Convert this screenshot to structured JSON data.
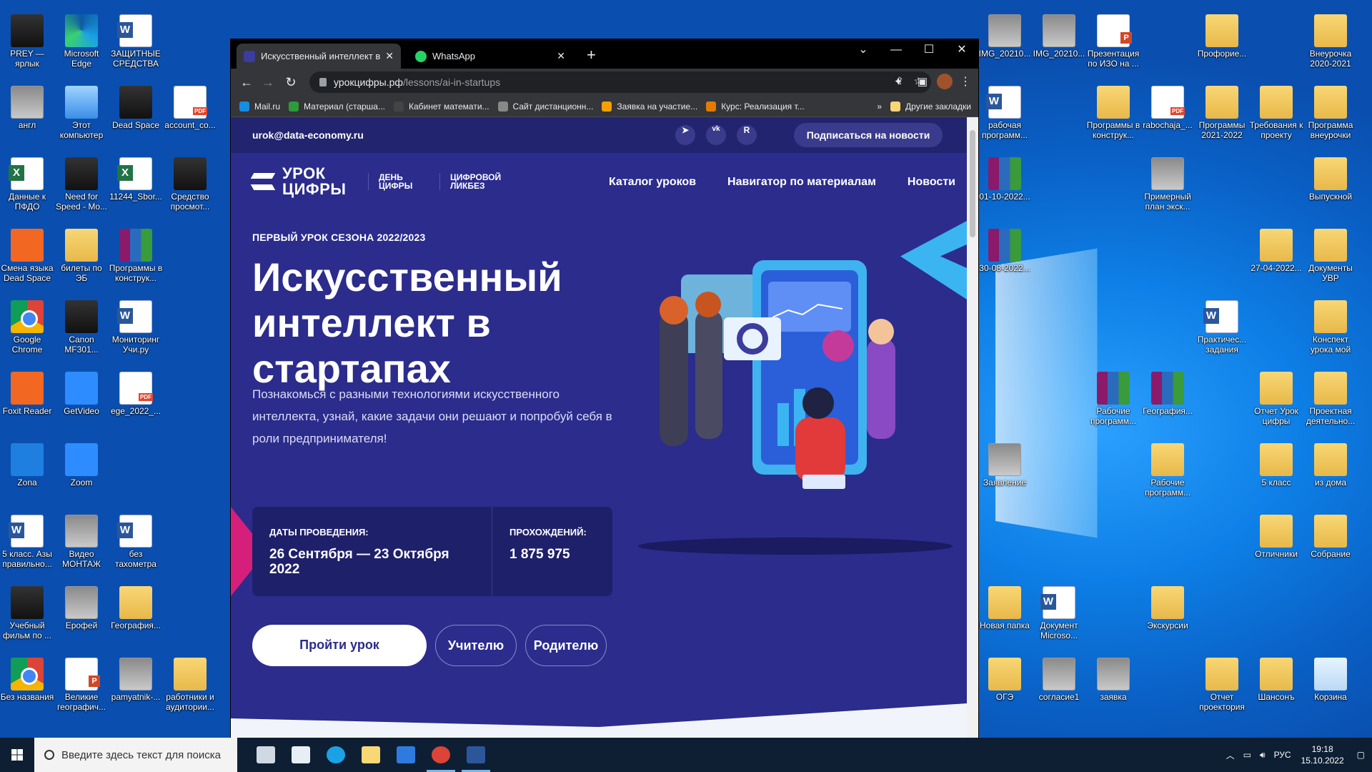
{
  "desktop": {
    "icons": [
      {
        "label": "PREY — ярлык",
        "type": "app"
      },
      {
        "label": "Microsoft Edge",
        "type": "edge"
      },
      {
        "label": "ЗАЩИТНЫЕ СРЕДСТВА",
        "type": "word"
      },
      {
        "label": "англ",
        "type": "photo"
      },
      {
        "label": "Этот компьютер",
        "type": "pc"
      },
      {
        "label": "Dead Space",
        "type": "app"
      },
      {
        "label": "account_co...",
        "type": "pdf"
      },
      {
        "label": "Данные к ПФДО",
        "type": "excel"
      },
      {
        "label": "Need for Speed - Mo...",
        "type": "app"
      },
      {
        "label": "11244_Sbor...",
        "type": "excel"
      },
      {
        "label": "Средство просмот...",
        "type": "app"
      },
      {
        "label": "Смена языка Dead Space",
        "type": "foxit"
      },
      {
        "label": "билеты по ЭБ",
        "type": "folder"
      },
      {
        "label": "Программы в конструк...",
        "type": "rar"
      },
      {
        "label": "Google Chrome",
        "type": "chrome"
      },
      {
        "label": "Canon MF301...",
        "type": "app"
      },
      {
        "label": "Мониторинг Учи.ру",
        "type": "word"
      },
      {
        "label": "Foxit Reader",
        "type": "foxit"
      },
      {
        "label": "GetVideo",
        "type": "blue"
      },
      {
        "label": "ege_2022_...",
        "type": "pdf"
      },
      {
        "label": "Zona",
        "type": "zona"
      },
      {
        "label": "Zoom",
        "type": "blue"
      },
      {
        "label": "5 класс. Азы правильно...",
        "type": "word"
      },
      {
        "label": "Видео МОНТАЖ",
        "type": "photo"
      },
      {
        "label": "без тахометра",
        "type": "word"
      },
      {
        "label": "Учебный фильм по ...",
        "type": "app"
      },
      {
        "label": "Ерофей",
        "type": "photo"
      },
      {
        "label": "География...",
        "type": "folder"
      },
      {
        "label": "Без названия",
        "type": "chrome"
      },
      {
        "label": "Великие географич...",
        "type": "ppt"
      },
      {
        "label": "pamyatnik-...",
        "type": "photo"
      },
      {
        "label": "работники и аудитории...",
        "type": "folder"
      },
      {
        "label": "IMG_20210...",
        "type": "photo"
      },
      {
        "label": "IMG_20210...",
        "type": "photo"
      },
      {
        "label": "Презентация по ИЗО на ...",
        "type": "ppt"
      },
      {
        "label": "Профорие...",
        "type": "folder"
      },
      {
        "label": "Внеурочка 2020-2021",
        "type": "folder"
      },
      {
        "label": "рабочая программ...",
        "type": "word"
      },
      {
        "label": "Программы в конструк...",
        "type": "folder"
      },
      {
        "label": "rabochaja_...",
        "type": "pdf"
      },
      {
        "label": "Программы 2021-2022",
        "type": "folder"
      },
      {
        "label": "Требования к проекту",
        "type": "folder"
      },
      {
        "label": "Программа внеурочки",
        "type": "folder"
      },
      {
        "label": "01-10-2022...",
        "type": "rar"
      },
      {
        "label": "Примерный план экск...",
        "type": "photo"
      },
      {
        "label": "Выпускной",
        "type": "folder"
      },
      {
        "label": "30-08-2022...",
        "type": "rar"
      },
      {
        "label": "27-04-2022...",
        "type": "folder"
      },
      {
        "label": "Документы УВР",
        "type": "folder"
      },
      {
        "label": "Практичес... задания",
        "type": "word"
      },
      {
        "label": "Конспект урока мой",
        "type": "folder"
      },
      {
        "label": "Рабочие программ...",
        "type": "rar"
      },
      {
        "label": "География...",
        "type": "rar"
      },
      {
        "label": "Отчет Урок цифры",
        "type": "folder"
      },
      {
        "label": "Проектная деятельно...",
        "type": "folder"
      },
      {
        "label": "Заявление",
        "type": "photo"
      },
      {
        "label": "Рабочие программ...",
        "type": "folder"
      },
      {
        "label": "5 класс",
        "type": "folder"
      },
      {
        "label": "из дома",
        "type": "folder"
      },
      {
        "label": "Отличники",
        "type": "folder"
      },
      {
        "label": "Собрание",
        "type": "folder"
      },
      {
        "label": "Новая папка",
        "type": "folder"
      },
      {
        "label": "Документ Microso...",
        "type": "word"
      },
      {
        "label": "Экскурсии",
        "type": "folder"
      },
      {
        "label": "ОГЭ",
        "type": "folder"
      },
      {
        "label": "согласие1",
        "type": "photo"
      },
      {
        "label": "заявка",
        "type": "photo"
      },
      {
        "label": "Отчет проектория",
        "type": "folder"
      },
      {
        "label": "Шансонъ",
        "type": "folder"
      },
      {
        "label": "Корзина",
        "type": "bin"
      }
    ]
  },
  "browser": {
    "tabs": [
      {
        "title": "Искусственный интеллект в ста",
        "active": true,
        "favicon_color": "#3b3c9c"
      },
      {
        "title": "WhatsApp",
        "active": false,
        "favicon_color": "#25d366"
      }
    ],
    "new_tab": "+",
    "controls": {
      "menu": "⌄",
      "minimize": "—",
      "maximize": "☐",
      "close": "✕"
    },
    "url_host": "урокцифры.рф",
    "url_path": "/lessons/ai-in-startups",
    "bookmarks": [
      {
        "label": "Mail.ru",
        "color": "#168de2"
      },
      {
        "label": "Материал (старша...",
        "color": "#2e9b3a"
      },
      {
        "label": "Кабинет математи...",
        "color": "#444"
      },
      {
        "label": "Сайт дистанционн...",
        "color": "#888"
      },
      {
        "label": "Заявка на участие...",
        "color": "#f4a100"
      },
      {
        "label": "Курс: Реализация т...",
        "color": "#e37b00"
      }
    ],
    "bookmarks_overflow": "»",
    "other_bookmarks": "Другие закладки"
  },
  "page": {
    "email": "urok@data-economy.ru",
    "social": [
      "➤",
      "vk",
      "R"
    ],
    "subscribe": "Подписаться на новости",
    "logo_main": "УРОК ЦИФРЫ",
    "logo_sub1": "ДЕНЬ ЦИФРЫ",
    "logo_sub2": "ЦИФРОВОЙ ЛИКБЕЗ",
    "nav": [
      "Каталог уроков",
      "Навигатор по материалам",
      "Новости"
    ],
    "eyebrow": "ПЕРВЫЙ УРОК СЕЗОНА 2022/2023",
    "headline": "Искусственный интеллект в стартапах",
    "lead": "Познакомься с разными технологиями искусственного интеллекта, узнай, какие задачи они решают и попробуй себя в роли предпринимателя!",
    "dates_label": "ДАТЫ ПРОВЕДЕНИЯ:",
    "dates_value": "26 Сентября — 23 Октября 2022",
    "passes_label": "ПРОХОЖДЕНИЙ:",
    "passes_value": "1 875 975",
    "btn_primary": "Пройти урок",
    "btn_teacher": "Учителю",
    "btn_parent": "Родителю"
  },
  "taskbar": {
    "search_placeholder": "Введите здесь текст для поиска",
    "apps": [
      {
        "name": "task-view",
        "color": "#cfd8e3",
        "active": false
      },
      {
        "name": "store",
        "color": "#e8eef5",
        "active": false
      },
      {
        "name": "edge",
        "color": "#1ba2e5",
        "active": false
      },
      {
        "name": "explorer",
        "color": "#f8d775",
        "active": false
      },
      {
        "name": "mail",
        "color": "#2d7be0",
        "active": false
      },
      {
        "name": "chrome",
        "color": "#db4437",
        "active": true
      },
      {
        "name": "word",
        "color": "#2b579a",
        "active": true
      }
    ],
    "lang": "РУС",
    "time": "19:18",
    "date": "15.10.2022"
  },
  "colors": {
    "page_bg": "#2b2c8c",
    "accent_pink": "#d61f7a",
    "accent_cyan": "#3bb4f2"
  }
}
